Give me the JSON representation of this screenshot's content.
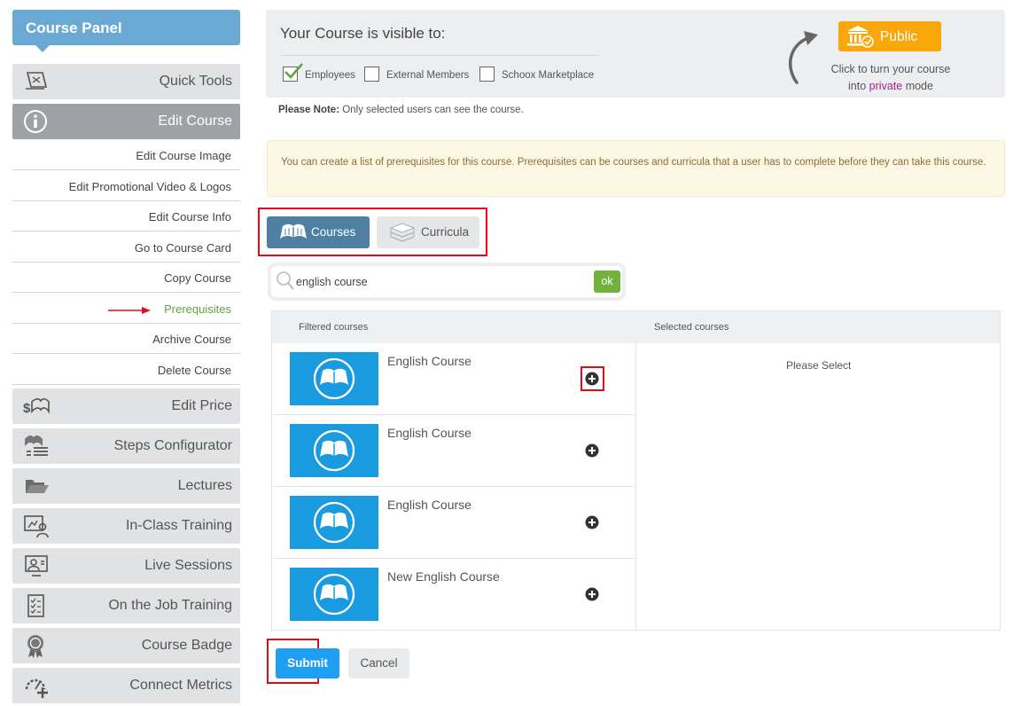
{
  "sidebar": {
    "header": "Course Panel",
    "top_items": [
      {
        "label": "Quick Tools",
        "icon": "quick-tools-icon"
      },
      {
        "label": "Edit Course",
        "icon": "info-icon"
      }
    ],
    "sub_items": [
      {
        "label": "Edit Course Image"
      },
      {
        "label": "Edit Promotional Video & Logos"
      },
      {
        "label": "Edit Course Info"
      },
      {
        "label": "Go to Course Card"
      },
      {
        "label": "Copy Course"
      },
      {
        "label": "Prerequisites"
      },
      {
        "label": "Archive Course"
      },
      {
        "label": "Delete Course"
      }
    ],
    "bottom_items": [
      {
        "label": "Edit Price",
        "icon": "price-icon"
      },
      {
        "label": "Steps Configurator",
        "icon": "steps-icon"
      },
      {
        "label": "Lectures",
        "icon": "folder-icon"
      },
      {
        "label": "In-Class Training",
        "icon": "classroom-icon"
      },
      {
        "label": "Live Sessions",
        "icon": "live-session-icon"
      },
      {
        "label": "On the Job Training",
        "icon": "checklist-icon"
      },
      {
        "label": "Course Badge",
        "icon": "badge-icon"
      },
      {
        "label": "Connect Metrics",
        "icon": "metrics-icon"
      }
    ]
  },
  "visibility": {
    "title": "Your Course is visible to:",
    "options": [
      {
        "label": "Employees",
        "checked": true
      },
      {
        "label": "External Members",
        "checked": false
      },
      {
        "label": "Schoox Marketplace",
        "checked": false
      }
    ],
    "public_label": "Public",
    "help_line1": "Click to turn your course",
    "help_into": "into",
    "help_private": "private",
    "help_mode": "mode"
  },
  "note": {
    "bold": "Please Note:",
    "text": " Only selected users can see the course."
  },
  "info": "You can create a list of prerequisites for this course. Prerequisites can be courses and curricula that a user has to complete before they can take this course.",
  "tabs": {
    "courses": "Courses",
    "curricula": "Curricula"
  },
  "search": {
    "value": "english course",
    "ok": "ok"
  },
  "table": {
    "filtered_header": "Filtered courses",
    "selected_header": "Selected courses",
    "rows": [
      {
        "title": "English Course"
      },
      {
        "title": "English Course"
      },
      {
        "title": "English Course"
      },
      {
        "title": "New English Course"
      }
    ],
    "empty_text": "Please Select"
  },
  "actions": {
    "submit": "Submit",
    "cancel": "Cancel"
  },
  "colors": {
    "sidebar_header": "#6aa9d4",
    "active_menu": "#9ea2a6",
    "public_button": "#f9a70b",
    "courses_tab": "#4f7fa3",
    "thumbnail": "#1a9be0",
    "submit": "#1e9ff2",
    "ok": "#71b23d",
    "highlight": "#e30b17",
    "prerequisites_text": "#5ca53b"
  }
}
